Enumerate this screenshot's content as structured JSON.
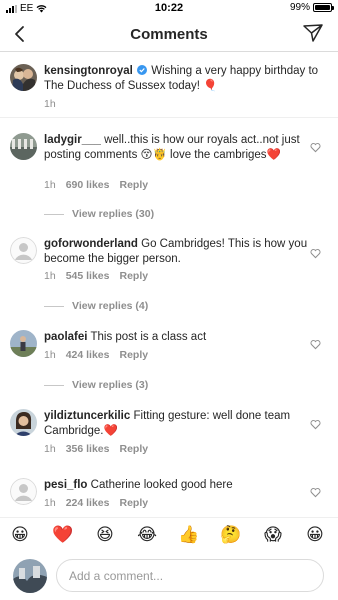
{
  "status_bar": {
    "carrier": "EE",
    "time": "10:22",
    "battery_text": "99%",
    "battery_level": 0.99
  },
  "nav": {
    "title": "Comments",
    "back_icon": "chevron-left-icon",
    "share_icon": "paper-plane-icon"
  },
  "caption": {
    "username": "kensingtonroyal",
    "verified_icon": "verified-badge-icon",
    "text": "Wishing a very happy birthday to The Duchess of Sussex today! 🎈",
    "time": "1h"
  },
  "comments": [
    {
      "username": "ladygir___",
      "text": "well..this is how our royals act..not just posting comments 😚🤴 love the cambriges❤️",
      "time": "1h",
      "likes": "690 likes",
      "reply": "Reply",
      "view_replies": "View replies (30)"
    },
    {
      "username": "goforwonderland",
      "text": "Go Cambridges! This is how you become the bigger person.",
      "time": "1h",
      "likes": "545 likes",
      "reply": "Reply",
      "view_replies": "View replies (4)"
    },
    {
      "username": "paolafei",
      "text": "This post is a class act",
      "time": "1h",
      "likes": "424 likes",
      "reply": "Reply",
      "view_replies": "View replies (3)"
    },
    {
      "username": "yildiztuncerkilic",
      "text": "Fitting gesture: well done team Cambridge.❤️",
      "time": "1h",
      "likes": "356 likes",
      "reply": "Reply"
    },
    {
      "username": "pesi_flo",
      "text": "Catherine looked good here",
      "time": "1h",
      "likes": "224 likes",
      "reply": "Reply"
    }
  ],
  "emoji_bar": [
    "😀",
    "❤️",
    "😆",
    "😂",
    "👍",
    "🤔",
    "😱",
    "😀"
  ],
  "input": {
    "placeholder": "Add a comment..."
  },
  "colors": {
    "text": "#262626",
    "secondary": "#8e8e8e",
    "verified": "#3897f0",
    "heart_red": "#ed4956",
    "divider": "#dbdbdb"
  }
}
